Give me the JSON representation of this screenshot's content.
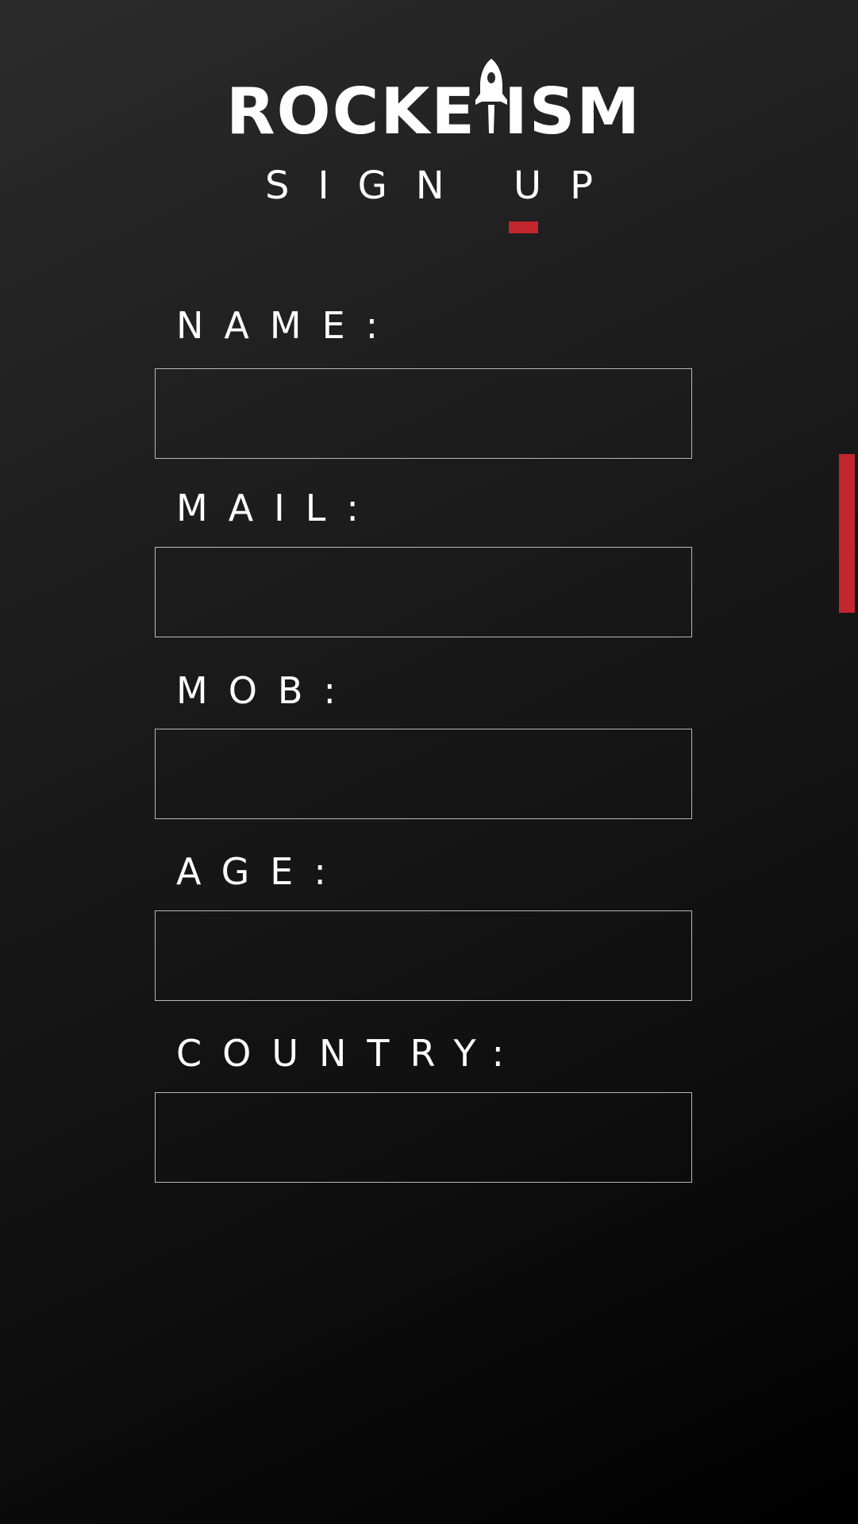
{
  "header": {
    "logo_text_left": "ROCKE",
    "logo_text_right": "ISM",
    "logo_icon": "rocket-icon",
    "subtitle": "SIGN UP"
  },
  "form": {
    "fields": [
      {
        "label": "NAME:",
        "value": "",
        "placeholder": ""
      },
      {
        "label": "MAIL:",
        "value": "",
        "placeholder": ""
      },
      {
        "label": "MOB:",
        "value": "",
        "placeholder": ""
      },
      {
        "label": "AGE:",
        "value": "",
        "placeholder": ""
      },
      {
        "label": "COUNTRY:",
        "value": "",
        "placeholder": ""
      }
    ]
  },
  "colors": {
    "accent": "#c1272d",
    "text": "#ffffff",
    "input_border": "#b8b8b8",
    "background_top": "#2b2b2b",
    "background_bottom": "#000000"
  }
}
